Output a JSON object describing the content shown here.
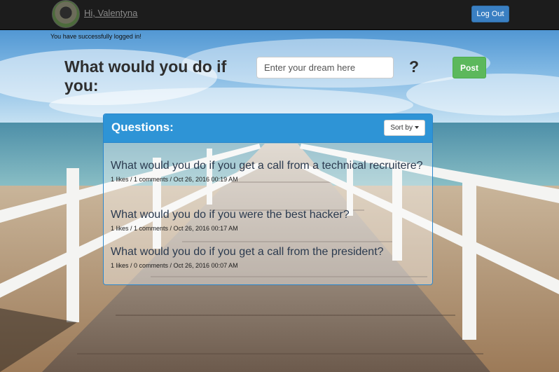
{
  "navbar": {
    "greeting": "Hi, Valentyna",
    "logout_label": "Log Out"
  },
  "flash": "You have successfully logged in!",
  "prompt": {
    "heading": "What would you do if you:",
    "input_placeholder": "Enter your dream here",
    "question_mark": "?",
    "post_label": "Post"
  },
  "panel": {
    "title": "Questions:",
    "sort_label": "Sort by",
    "questions": [
      {
        "title": "What would you do if you get a call from a technical recruitere?",
        "meta": "1 likes / 1 comments / Oct 26, 2016 00:19 AM"
      },
      {
        "title": "What would you do if you were the best hacker?",
        "meta": "1 likes / 1 comments / Oct 26, 2016 00:17 AM"
      },
      {
        "title": "What would you do if you get a call from the president?",
        "meta": "1 likes / 0 comments / Oct 26, 2016 00:07 AM"
      }
    ]
  },
  "colors": {
    "navbar": "#1c1c1c",
    "primary": "#2e94d6",
    "success": "#5cb85c",
    "logout": "#3a7fc2"
  }
}
